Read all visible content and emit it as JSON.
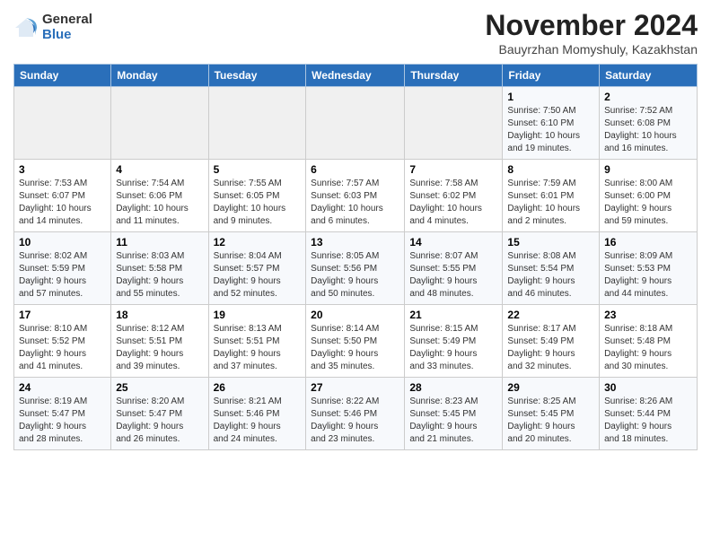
{
  "logo": {
    "general": "General",
    "blue": "Blue"
  },
  "header": {
    "month": "November 2024",
    "location": "Bauyrzhan Momyshuly, Kazakhstan"
  },
  "weekdays": [
    "Sunday",
    "Monday",
    "Tuesday",
    "Wednesday",
    "Thursday",
    "Friday",
    "Saturday"
  ],
  "weeks": [
    [
      {
        "day": "",
        "info": ""
      },
      {
        "day": "",
        "info": ""
      },
      {
        "day": "",
        "info": ""
      },
      {
        "day": "",
        "info": ""
      },
      {
        "day": "",
        "info": ""
      },
      {
        "day": "1",
        "info": "Sunrise: 7:50 AM\nSunset: 6:10 PM\nDaylight: 10 hours\nand 19 minutes."
      },
      {
        "day": "2",
        "info": "Sunrise: 7:52 AM\nSunset: 6:08 PM\nDaylight: 10 hours\nand 16 minutes."
      }
    ],
    [
      {
        "day": "3",
        "info": "Sunrise: 7:53 AM\nSunset: 6:07 PM\nDaylight: 10 hours\nand 14 minutes."
      },
      {
        "day": "4",
        "info": "Sunrise: 7:54 AM\nSunset: 6:06 PM\nDaylight: 10 hours\nand 11 minutes."
      },
      {
        "day": "5",
        "info": "Sunrise: 7:55 AM\nSunset: 6:05 PM\nDaylight: 10 hours\nand 9 minutes."
      },
      {
        "day": "6",
        "info": "Sunrise: 7:57 AM\nSunset: 6:03 PM\nDaylight: 10 hours\nand 6 minutes."
      },
      {
        "day": "7",
        "info": "Sunrise: 7:58 AM\nSunset: 6:02 PM\nDaylight: 10 hours\nand 4 minutes."
      },
      {
        "day": "8",
        "info": "Sunrise: 7:59 AM\nSunset: 6:01 PM\nDaylight: 10 hours\nand 2 minutes."
      },
      {
        "day": "9",
        "info": "Sunrise: 8:00 AM\nSunset: 6:00 PM\nDaylight: 9 hours\nand 59 minutes."
      }
    ],
    [
      {
        "day": "10",
        "info": "Sunrise: 8:02 AM\nSunset: 5:59 PM\nDaylight: 9 hours\nand 57 minutes."
      },
      {
        "day": "11",
        "info": "Sunrise: 8:03 AM\nSunset: 5:58 PM\nDaylight: 9 hours\nand 55 minutes."
      },
      {
        "day": "12",
        "info": "Sunrise: 8:04 AM\nSunset: 5:57 PM\nDaylight: 9 hours\nand 52 minutes."
      },
      {
        "day": "13",
        "info": "Sunrise: 8:05 AM\nSunset: 5:56 PM\nDaylight: 9 hours\nand 50 minutes."
      },
      {
        "day": "14",
        "info": "Sunrise: 8:07 AM\nSunset: 5:55 PM\nDaylight: 9 hours\nand 48 minutes."
      },
      {
        "day": "15",
        "info": "Sunrise: 8:08 AM\nSunset: 5:54 PM\nDaylight: 9 hours\nand 46 minutes."
      },
      {
        "day": "16",
        "info": "Sunrise: 8:09 AM\nSunset: 5:53 PM\nDaylight: 9 hours\nand 44 minutes."
      }
    ],
    [
      {
        "day": "17",
        "info": "Sunrise: 8:10 AM\nSunset: 5:52 PM\nDaylight: 9 hours\nand 41 minutes."
      },
      {
        "day": "18",
        "info": "Sunrise: 8:12 AM\nSunset: 5:51 PM\nDaylight: 9 hours\nand 39 minutes."
      },
      {
        "day": "19",
        "info": "Sunrise: 8:13 AM\nSunset: 5:51 PM\nDaylight: 9 hours\nand 37 minutes."
      },
      {
        "day": "20",
        "info": "Sunrise: 8:14 AM\nSunset: 5:50 PM\nDaylight: 9 hours\nand 35 minutes."
      },
      {
        "day": "21",
        "info": "Sunrise: 8:15 AM\nSunset: 5:49 PM\nDaylight: 9 hours\nand 33 minutes."
      },
      {
        "day": "22",
        "info": "Sunrise: 8:17 AM\nSunset: 5:49 PM\nDaylight: 9 hours\nand 32 minutes."
      },
      {
        "day": "23",
        "info": "Sunrise: 8:18 AM\nSunset: 5:48 PM\nDaylight: 9 hours\nand 30 minutes."
      }
    ],
    [
      {
        "day": "24",
        "info": "Sunrise: 8:19 AM\nSunset: 5:47 PM\nDaylight: 9 hours\nand 28 minutes."
      },
      {
        "day": "25",
        "info": "Sunrise: 8:20 AM\nSunset: 5:47 PM\nDaylight: 9 hours\nand 26 minutes."
      },
      {
        "day": "26",
        "info": "Sunrise: 8:21 AM\nSunset: 5:46 PM\nDaylight: 9 hours\nand 24 minutes."
      },
      {
        "day": "27",
        "info": "Sunrise: 8:22 AM\nSunset: 5:46 PM\nDaylight: 9 hours\nand 23 minutes."
      },
      {
        "day": "28",
        "info": "Sunrise: 8:23 AM\nSunset: 5:45 PM\nDaylight: 9 hours\nand 21 minutes."
      },
      {
        "day": "29",
        "info": "Sunrise: 8:25 AM\nSunset: 5:45 PM\nDaylight: 9 hours\nand 20 minutes."
      },
      {
        "day": "30",
        "info": "Sunrise: 8:26 AM\nSunset: 5:44 PM\nDaylight: 9 hours\nand 18 minutes."
      }
    ]
  ]
}
